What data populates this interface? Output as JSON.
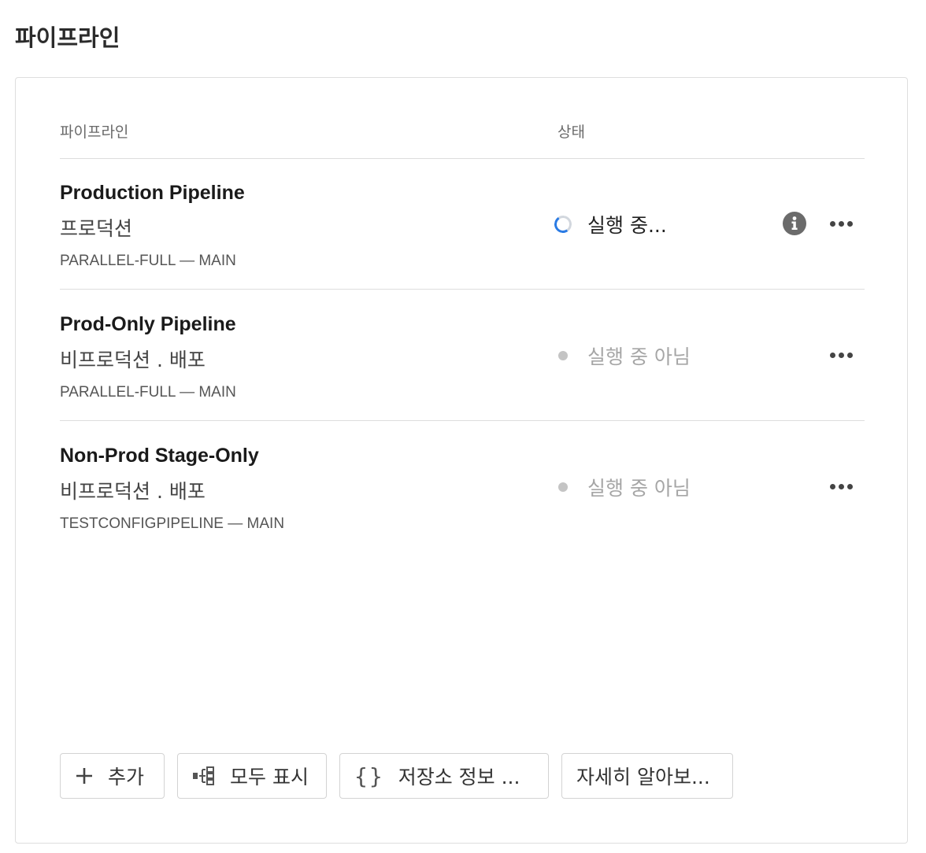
{
  "page": {
    "title": "파이프라인"
  },
  "table": {
    "headers": {
      "pipeline": "파이프라인",
      "status": "상태"
    },
    "rows": [
      {
        "name": "Production Pipeline",
        "subtitle": "프로덕션",
        "meta": "PARALLEL-FULL — MAIN",
        "status": "실행 중...",
        "status_kind": "running",
        "status_icon": "spinner-icon",
        "has_info": true
      },
      {
        "name": "Prod-Only Pipeline",
        "subtitle": "비프로덕션 . 배포",
        "meta": "PARALLEL-FULL — MAIN",
        "status": "실행 중 아님",
        "status_kind": "idle",
        "status_icon": "dot-icon",
        "has_info": false
      },
      {
        "name": "Non-Prod Stage-Only",
        "subtitle": "비프로덕션 . 배포",
        "meta": "TESTCONFIGPIPELINE — MAIN",
        "status": "실행 중 아님",
        "status_kind": "idle",
        "status_icon": "dot-icon",
        "has_info": false
      }
    ]
  },
  "toolbar": {
    "add_label": "추가",
    "show_all_label": "모두 표시",
    "repo_info_label": "저장소 정보 ...",
    "learn_more_label": "자세히 알아보..."
  },
  "colors": {
    "spinner_accent": "#2a7be4",
    "idle_dot": "#c4c4c4",
    "idle_text": "#a6a6a6",
    "info_icon": "#6b6b6b"
  }
}
